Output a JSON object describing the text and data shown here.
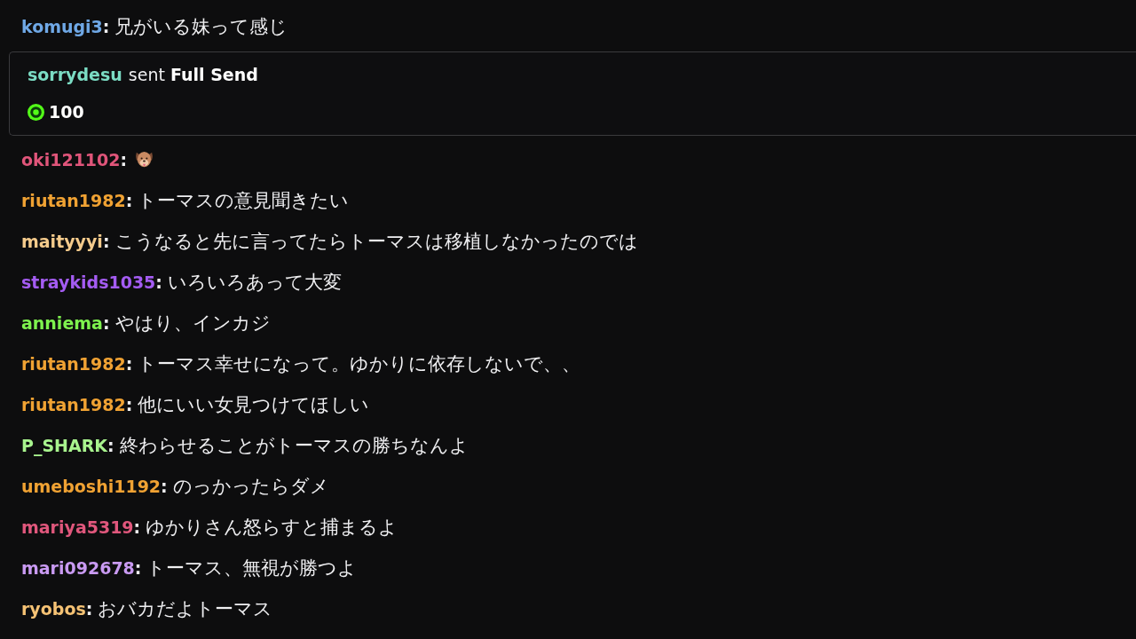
{
  "chat": {
    "messages": [
      {
        "kind": "text",
        "user": "komugi3",
        "color": "#6fa8e6",
        "separator": ":",
        "text": "兄がいる妹って感じ"
      },
      {
        "kind": "gift",
        "user": "sorrydesu",
        "color": "#7bdcc4",
        "text": "sent **Full Send**",
        "amount": "100"
      },
      {
        "kind": "emoji",
        "user": "oki121102",
        "color": "#e0557a",
        "separator": ":"
      },
      {
        "kind": "text",
        "user": "riutan1982",
        "color": "#f0a233",
        "separator": ":",
        "text": "トーマスの意見聞きたい"
      },
      {
        "kind": "text",
        "user": "maityyyi",
        "color": "#f5cb8c",
        "separator": ":",
        "text": "こうなると先に言ってたらトーマスは移植しなかったのでは"
      },
      {
        "kind": "text",
        "user": "straykids1035",
        "color": "#a45cf2",
        "separator": ":",
        "text": "いろいろあって大変"
      },
      {
        "kind": "text",
        "user": "anniema",
        "color": "#7ef24e",
        "separator": ":",
        "text": "やはり、インカジ"
      },
      {
        "kind": "text",
        "user": "riutan1982",
        "color": "#f0a233",
        "separator": ":",
        "text": "トーマス幸せになって。ゆかりに依存しないで、、"
      },
      {
        "kind": "text",
        "user": "riutan1982",
        "color": "#f0a233",
        "separator": ":",
        "text": "他にいい女見つけてほしい"
      },
      {
        "kind": "text",
        "user": "P_SHARK",
        "color": "#a8f48e",
        "separator": ":",
        "text": "終わらせることがトーマスの勝ちなんよ"
      },
      {
        "kind": "text",
        "user": "umeboshi1192",
        "color": "#f0a233",
        "separator": ":",
        "text": "のっかったらダメ"
      },
      {
        "kind": "text",
        "user": "mariya5319",
        "color": "#e0577c",
        "separator": ":",
        "text": "ゆかりさん怒らすと捕まるよ"
      },
      {
        "kind": "text",
        "user": "mari092678",
        "color": "#c99af2",
        "separator": ":",
        "text": "トーマス、無視が勝つよ"
      },
      {
        "kind": "text",
        "user": "ryobos",
        "color": "#f5c274",
        "separator": ":",
        "text": "おバカだよトーマス"
      }
    ]
  }
}
